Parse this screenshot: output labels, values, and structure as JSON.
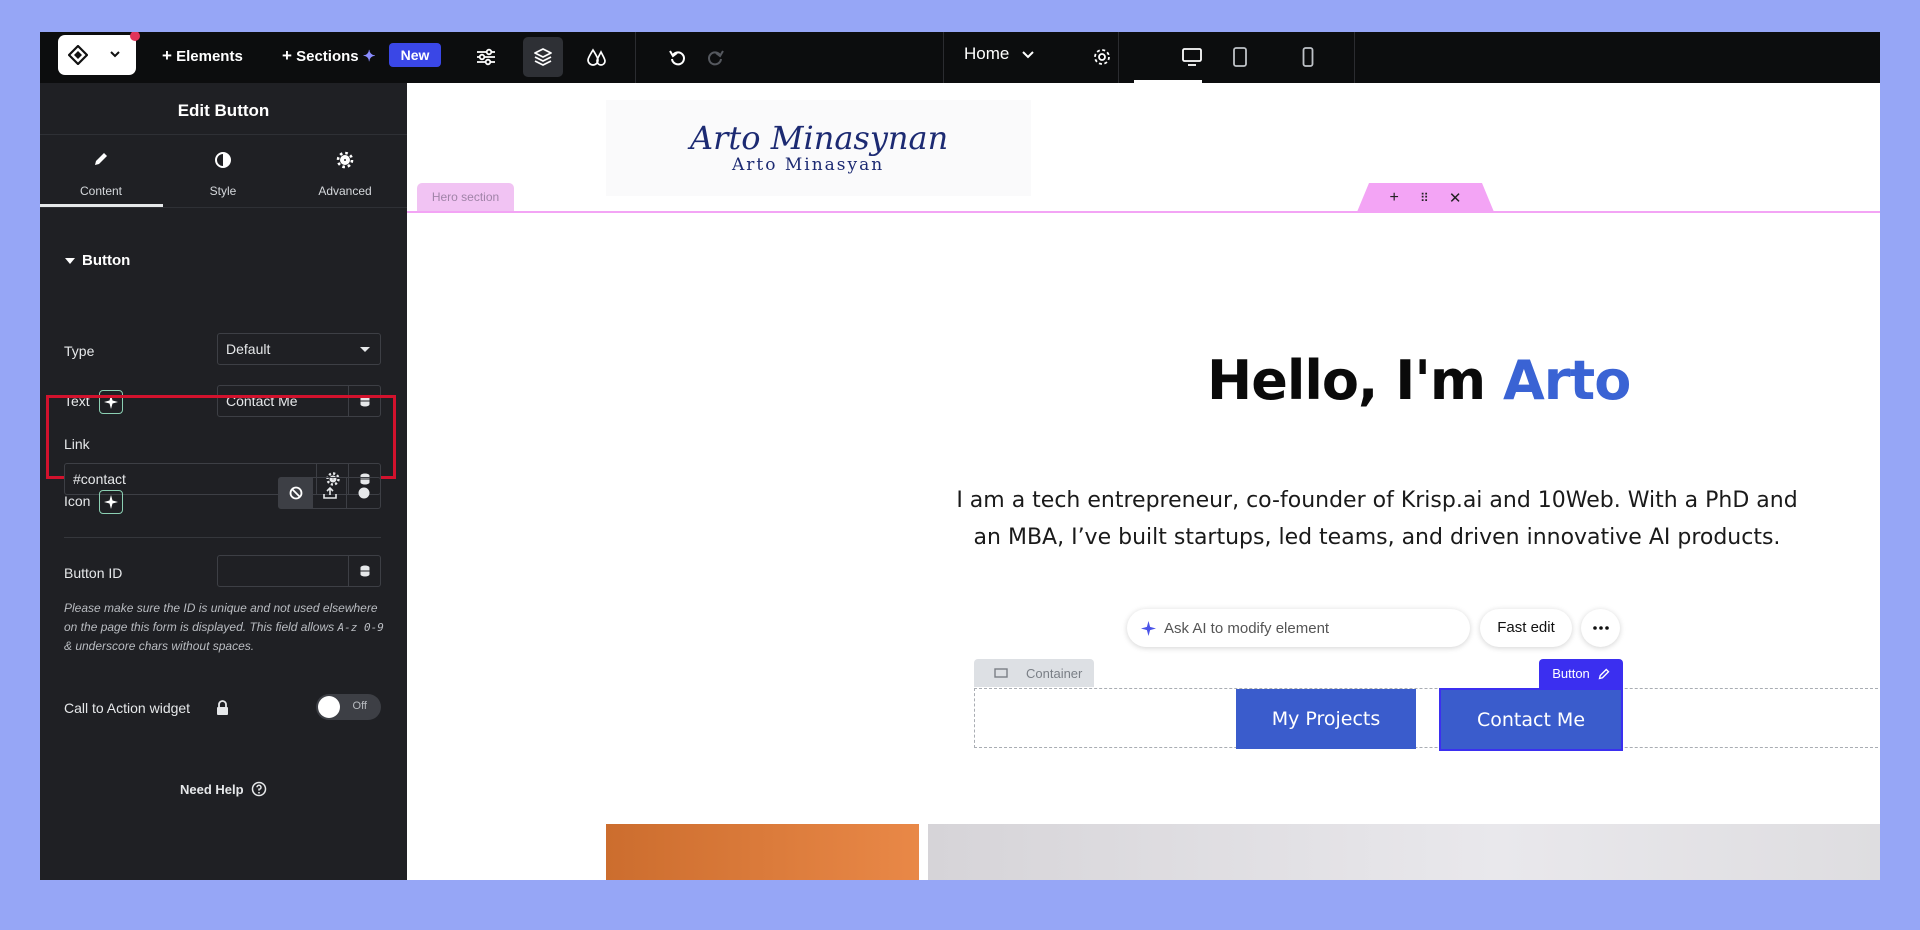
{
  "topbar": {
    "elements_label": "Elements",
    "sections_label": "Sections",
    "new_badge": "New",
    "page_name": "Home"
  },
  "panel": {
    "title": "Edit Button",
    "tabs": [
      {
        "label": "Content",
        "icon": "pencil-icon",
        "active": true
      },
      {
        "label": "Style",
        "icon": "contrast-icon",
        "active": false
      },
      {
        "label": "Advanced",
        "icon": "gear-icon",
        "active": false
      }
    ],
    "section_title": "Button",
    "type_label": "Type",
    "type_value": "Default",
    "text_label": "Text",
    "text_value": "Contact Me",
    "link_label": "Link",
    "link_value": "#contact",
    "icon_label": "Icon",
    "button_id_label": "Button ID",
    "button_id_value": "",
    "hint_prefix": "Please make sure the ID is unique and not used elsewhere on the page this form is displayed. This field allows ",
    "hint_code": "A-z 0-9",
    "hint_suffix": " & underscore chars without spaces.",
    "cta_label": "Call to Action widget",
    "cta_toggle": "Off",
    "need_help": "Need Help"
  },
  "canvas": {
    "signature_line1": "Arto Minasynan",
    "signature_line2": "Arto Minasyan",
    "hero_section_tag": "Hero section",
    "hero_title_prefix": "Hello, I'm ",
    "hero_title_accent": "Arto",
    "hero_description": "I am a tech entrepreneur, co-founder of Krisp.ai and 10Web. With a PhD and an MBA, I’ve built startups, led teams, and driven innovative AI products.",
    "ai_placeholder": "Ask AI to modify element",
    "fast_edit": "Fast edit",
    "container_tag": "Container",
    "button_tag": "Button",
    "projects_button": "My Projects",
    "contact_button": "Contact Me"
  },
  "colors": {
    "accent": "#3a63d4",
    "button_bg": "#3a5ccc",
    "selection": "#3b2ff0",
    "highlight": "#d2122d",
    "panel_bg": "#1f2024"
  }
}
